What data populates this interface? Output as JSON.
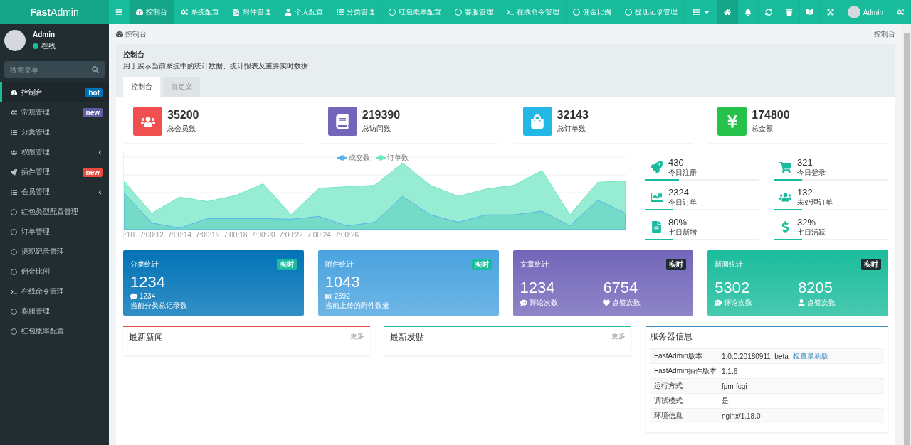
{
  "logo": {
    "bold": "Fast",
    "rest": "Admin"
  },
  "topnav": [
    {
      "label": "控制台",
      "selected": true
    },
    {
      "label": "系统配置",
      "selected": false
    },
    {
      "label": "附件管理",
      "selected": false
    },
    {
      "label": "个人配置",
      "selected": false
    },
    {
      "label": "分类管理",
      "selected": false
    },
    {
      "label": "红包概率配置",
      "selected": false
    },
    {
      "label": "客服管理",
      "selected": false
    },
    {
      "label": "在线命令管理",
      "selected": false
    },
    {
      "label": "佣金比例",
      "selected": false
    },
    {
      "label": "提现记录管理",
      "selected": false
    }
  ],
  "top_user": "Admin",
  "user": {
    "name": "Admin",
    "status": "在线"
  },
  "search": {
    "placeholder": "搜索菜单"
  },
  "sidebar": [
    {
      "label": "控制台",
      "kind": "link",
      "selected": true,
      "badge": "hot",
      "color": "#0073b7"
    },
    {
      "label": "常规管理",
      "kind": "link",
      "selected": false,
      "badge": "new",
      "color": "#605ca8"
    },
    {
      "label": "分类管理",
      "kind": "link",
      "selected": false
    },
    {
      "label": "权限管理",
      "kind": "group",
      "selected": false
    },
    {
      "label": "插件管理",
      "kind": "link",
      "selected": false,
      "badge": "new",
      "color": "#e74c3c"
    },
    {
      "label": "会员管理",
      "kind": "group",
      "selected": false
    },
    {
      "label": "红包类型配置管理",
      "kind": "link",
      "selected": false
    },
    {
      "label": "订单管理",
      "kind": "link",
      "selected": false
    },
    {
      "label": "提现记录管理",
      "kind": "link",
      "selected": false
    },
    {
      "label": "佣金比例",
      "kind": "link",
      "selected": false
    },
    {
      "label": "在线命令管理",
      "kind": "link",
      "selected": false
    },
    {
      "label": "客服管理",
      "kind": "link",
      "selected": false
    },
    {
      "label": "红包概率配置",
      "kind": "link",
      "selected": false
    }
  ],
  "breadcrumb": {
    "left": "控制台",
    "right": "控制台"
  },
  "panel": {
    "title": "控制台",
    "description": "用于展示当前系统中的统计数据、统计报表及重要实时数据"
  },
  "tabs": [
    {
      "label": "控制台",
      "selected": true
    },
    {
      "label": "自定义",
      "selected": false
    }
  ],
  "stats": [
    {
      "value": "35200",
      "label": "总会员数",
      "color": "#f05050"
    },
    {
      "value": "219390",
      "label": "总访问数",
      "color": "#7266ba"
    },
    {
      "value": "32143",
      "label": "总订单数",
      "color": "#23b7e5"
    },
    {
      "value": "174800",
      "label": "总金额",
      "color": "#27c24c"
    }
  ],
  "chart": {
    "legend": [
      {
        "name": "成交数",
        "color": "#5ab1ef"
      },
      {
        "name": "订单数",
        "color": "#6be6c1"
      }
    ],
    "x_labels": [
      ":10",
      "7:00:12",
      "7:00:14",
      "7:00:16",
      "7:00:18",
      "7:00:20",
      "7:00:22",
      "7:00:24",
      "7:00:26"
    ]
  },
  "mini_stats": [
    {
      "value": "430",
      "label": "今日注册",
      "level": 0.3
    },
    {
      "value": "321",
      "label": "今日登录",
      "level": 0.25
    },
    {
      "value": "2324",
      "label": "今日订单",
      "level": 0.25
    },
    {
      "value": "132",
      "label": "未处理订单",
      "level": 0.25
    },
    {
      "value": "80%",
      "label": "七日新增",
      "level": 0.25
    },
    {
      "value": "32%",
      "label": "七日活跃",
      "level": 0.25
    }
  ],
  "cards": [
    {
      "kind": "single",
      "title": "分类统计",
      "badge": "实时",
      "color": "#0073b7",
      "value": "1234",
      "sub": "1234",
      "desc": "当前分类总记录数"
    },
    {
      "kind": "single",
      "title": "附件统计",
      "badge": "实时",
      "color": "#4aa3df",
      "value": "1043",
      "sub": "2592",
      "desc": "当前上传的附件数量"
    },
    {
      "kind": "double",
      "title": "文章统计",
      "badge": "实时",
      "color": "#7266ba",
      "items": [
        {
          "value": "1234",
          "label": "评论次数"
        },
        {
          "value": "6754",
          "label": "点赞次数"
        }
      ]
    },
    {
      "kind": "double",
      "title": "新闻统计",
      "badge": "实时",
      "color": "#1abc9c",
      "items": [
        {
          "value": "5302",
          "label": "评论次数"
        },
        {
          "value": "8205",
          "label": "点赞次数"
        }
      ]
    }
  ],
  "news": [
    {
      "title": "最新新闻",
      "more": "更多",
      "color": "#e74c3c"
    },
    {
      "title": "最新发贴",
      "more": "更多",
      "color": "#18bc9c"
    }
  ],
  "server": {
    "title": "服务器信息",
    "color": "#3c8dbc",
    "rows": [
      {
        "name": "FastAdmin版本",
        "value": "1.0.0.20180911_beta",
        "link": "检查最新版"
      },
      {
        "name": "FastAdmin插件版本",
        "value": "1.1.6"
      },
      {
        "name": "运行方式",
        "value": "fpm-fcgi"
      },
      {
        "name": "调试模式",
        "value": "是"
      },
      {
        "name": "环境信息",
        "value": "nginx/1.18.0"
      }
    ]
  }
}
